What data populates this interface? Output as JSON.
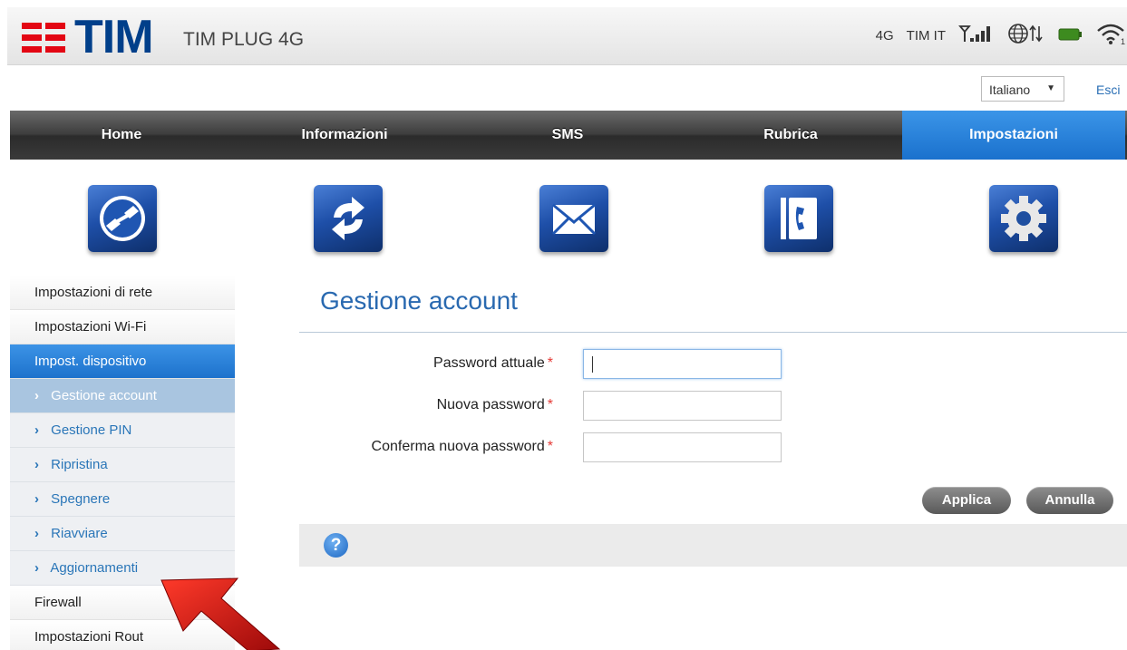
{
  "header": {
    "brand": "TIM",
    "product": "TIM PLUG 4G",
    "network_type": "4G",
    "operator": "TIM IT",
    "icons": [
      "signal-icon",
      "globe-data-icon",
      "battery-icon",
      "wifi-icon"
    ]
  },
  "language": {
    "selected": "Italiano",
    "logout": "Esci"
  },
  "nav": {
    "items": [
      "Home",
      "Informazioni",
      "SMS",
      "Rubrica",
      "Impostazioni"
    ],
    "active": "Impostazioni"
  },
  "tiles": [
    "connection-icon",
    "refresh-icon",
    "envelope-icon",
    "phonebook-icon",
    "gear-icon"
  ],
  "sidebar": {
    "top_items": [
      "Impostazioni di rete",
      "Impostazioni Wi-Fi"
    ],
    "active_item": "Impost. dispositivo",
    "sub_items": [
      "Gestione account",
      "Gestione PIN",
      "Ripristina",
      "Spegnere",
      "Riavviare",
      "Aggiornamenti"
    ],
    "bottom_items": [
      "Firewall",
      "Impostazioni Rout"
    ]
  },
  "main": {
    "title": "Gestione account",
    "fields": [
      {
        "label": "Password attuale",
        "value": ""
      },
      {
        "label": "Nuova password",
        "value": ""
      },
      {
        "label": "Conferma nuova password",
        "value": ""
      }
    ],
    "required_mark": "*",
    "apply_label": "Applica",
    "cancel_label": "Annulla",
    "help_glyph": "?"
  },
  "colors": {
    "brand_red": "#e30613",
    "brand_blue": "#003f8a",
    "accent_blue": "#1d72cc",
    "link_blue": "#2a76b8"
  }
}
